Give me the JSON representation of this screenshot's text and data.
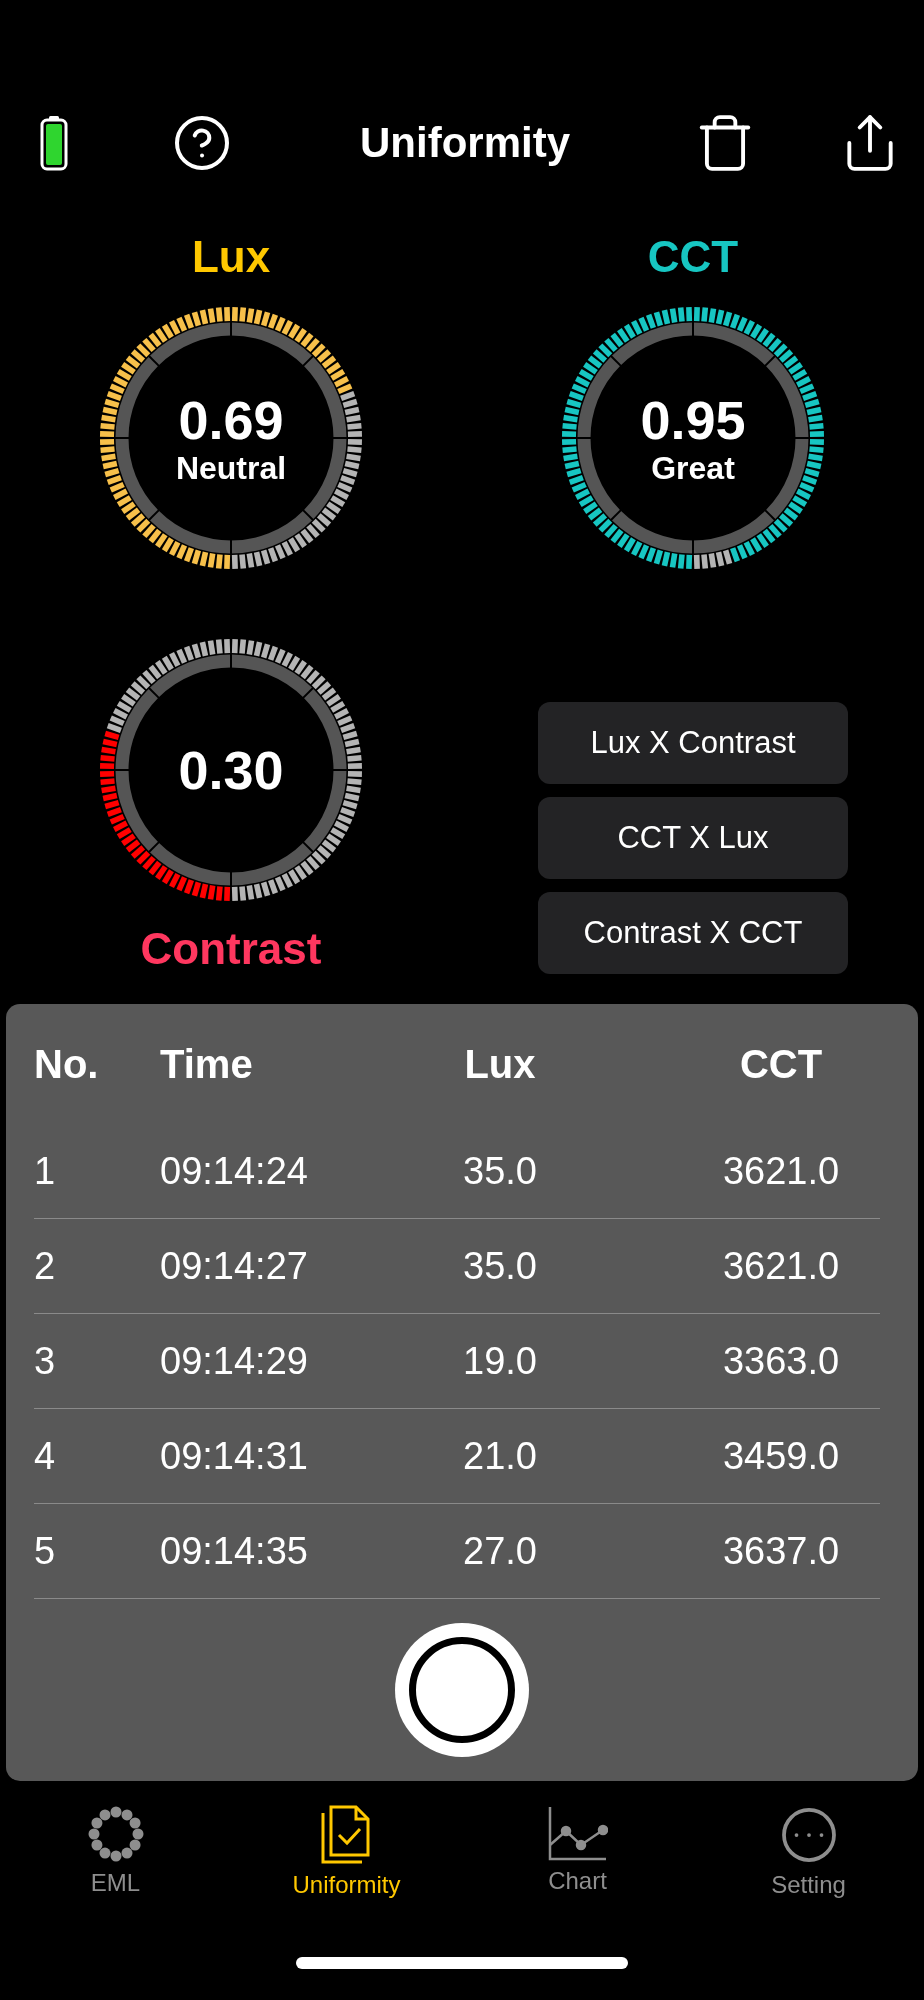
{
  "top_bar": {
    "title": "Uniformity"
  },
  "gauges": [
    {
      "kind": "label-top",
      "label": "Lux",
      "value": "0.69",
      "rating": "Neutral",
      "color": "#ffc800"
    },
    {
      "kind": "label-top",
      "label": "CCT",
      "value": "0.95",
      "rating": "Great",
      "color": "#17c6c2"
    },
    {
      "kind": "label-bottom",
      "label": "Contrast",
      "value": "0.30",
      "color": "#ff375f"
    }
  ],
  "compare_buttons": [
    "Lux X Contrast",
    "CCT X Lux",
    "Contrast X CCT"
  ],
  "table": {
    "columns": [
      "No.",
      "Time",
      "Lux",
      "CCT"
    ],
    "rows": [
      [
        "1",
        "09:14:24",
        "35.0",
        "3621.0"
      ],
      [
        "2",
        "09:14:27",
        "35.0",
        "3621.0"
      ],
      [
        "3",
        "09:14:29",
        "19.0",
        "3363.0"
      ],
      [
        "4",
        "09:14:31",
        "21.0",
        "3459.0"
      ],
      [
        "5",
        "09:14:35",
        "27.0",
        "3637.0"
      ]
    ]
  },
  "tabs": [
    {
      "kind": "eml",
      "label": "EML",
      "selected": false
    },
    {
      "kind": "uniformity",
      "label": "Uniformity",
      "selected": true
    },
    {
      "kind": "chart",
      "label": "Chart",
      "selected": false
    },
    {
      "kind": "setting",
      "label": "Setting",
      "selected": false
    }
  ]
}
